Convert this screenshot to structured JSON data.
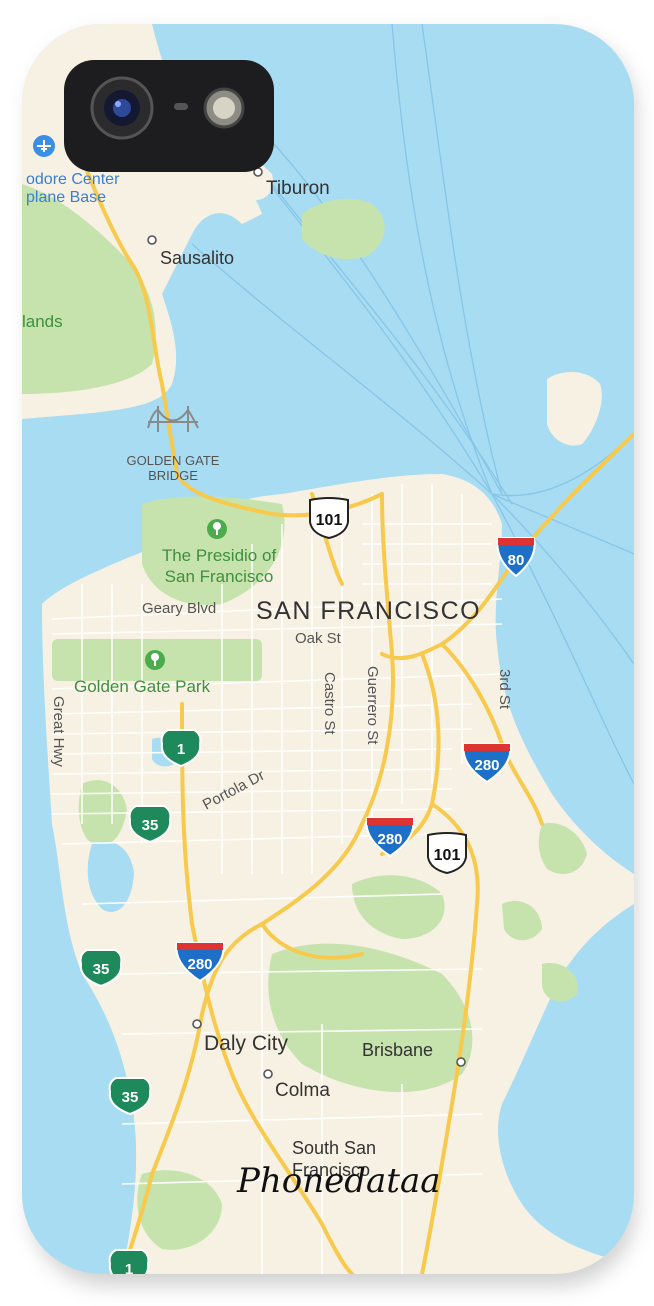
{
  "colors": {
    "water": "#a8dcf2",
    "land": "#f7f1e3",
    "park": "#c6e3ae",
    "park_dark": "#aed79b",
    "road_major": "#f7c94c",
    "road_minor": "#ffffff",
    "ferry": "#7cc0e4",
    "interstate": "#1d6fc7",
    "state_route": "#1e8a5b"
  },
  "places": {
    "tiburon": "Tiburon",
    "sausalito": "Sausalito",
    "airport_line1": "odore Center",
    "airport_line2": "plane Base",
    "islands": "lands",
    "golden_gate_line1": "GOLDEN GATE",
    "golden_gate_line2": "BRIDGE",
    "presidio_line1": "The Presidio of",
    "presidio_line2": "San Francisco",
    "san_francisco": "SAN FRANCISCO",
    "golden_gate_park": "Golden Gate Park",
    "daly_city": "Daly City",
    "colma": "Colma",
    "brisbane": "Brisbane",
    "south_sf_line1": "South San",
    "south_sf_line2": "Francisco"
  },
  "streets": {
    "geary": "Geary Blvd",
    "oak": "Oak St",
    "castro": "Castro St",
    "guerrero": "Guerrero St",
    "third": "3rd St",
    "great_hwy": "Great Hwy",
    "portola": "Portola Dr"
  },
  "shields": {
    "us101_a": "101",
    "us101_b": "101",
    "i80": "80",
    "i280_a": "280",
    "i280_b": "280",
    "i280_c": "280",
    "ca1_a": "1",
    "ca1_b": "1",
    "ca35_a": "35",
    "ca35_b": "35",
    "ca35_c": "35"
  },
  "watermark": "Phonedataa"
}
